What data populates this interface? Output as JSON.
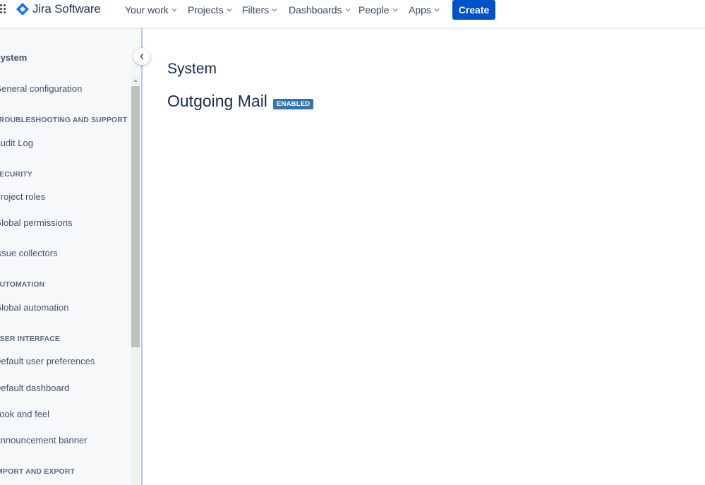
{
  "nav": {
    "logo_text": "Jira Software",
    "items": [
      "Your work",
      "Projects",
      "Filters",
      "Dashboards",
      "People",
      "Apps"
    ],
    "create_label": "Create"
  },
  "sidebar": {
    "title": "System",
    "entries": [
      {
        "type": "item",
        "label": "General configuration"
      },
      {
        "type": "section",
        "label": "TROUBLESHOOTING AND SUPPORT"
      },
      {
        "type": "item",
        "label": "Audit Log"
      },
      {
        "type": "section",
        "label": "SECURITY"
      },
      {
        "type": "item",
        "label": "Project roles"
      },
      {
        "type": "item",
        "label": "Global permissions"
      },
      {
        "type": "item",
        "label": "Issue collectors"
      },
      {
        "type": "section",
        "label": "AUTOMATION"
      },
      {
        "type": "item",
        "label": "Global automation"
      },
      {
        "type": "section",
        "label": "USER INTERFACE"
      },
      {
        "type": "item",
        "label": "Default user preferences"
      },
      {
        "type": "item",
        "label": "Default dashboard"
      },
      {
        "type": "item",
        "label": "Look and feel"
      },
      {
        "type": "item",
        "label": "Announcement banner"
      },
      {
        "type": "section",
        "label": "IMPORT AND EXPORT"
      }
    ]
  },
  "main": {
    "title": "System",
    "section_title": "Outgoing Mail",
    "status_badge": "ENABLED"
  },
  "colors": {
    "primary": "#0052cc",
    "badge": "#3572b0",
    "text": "#172b4d"
  }
}
